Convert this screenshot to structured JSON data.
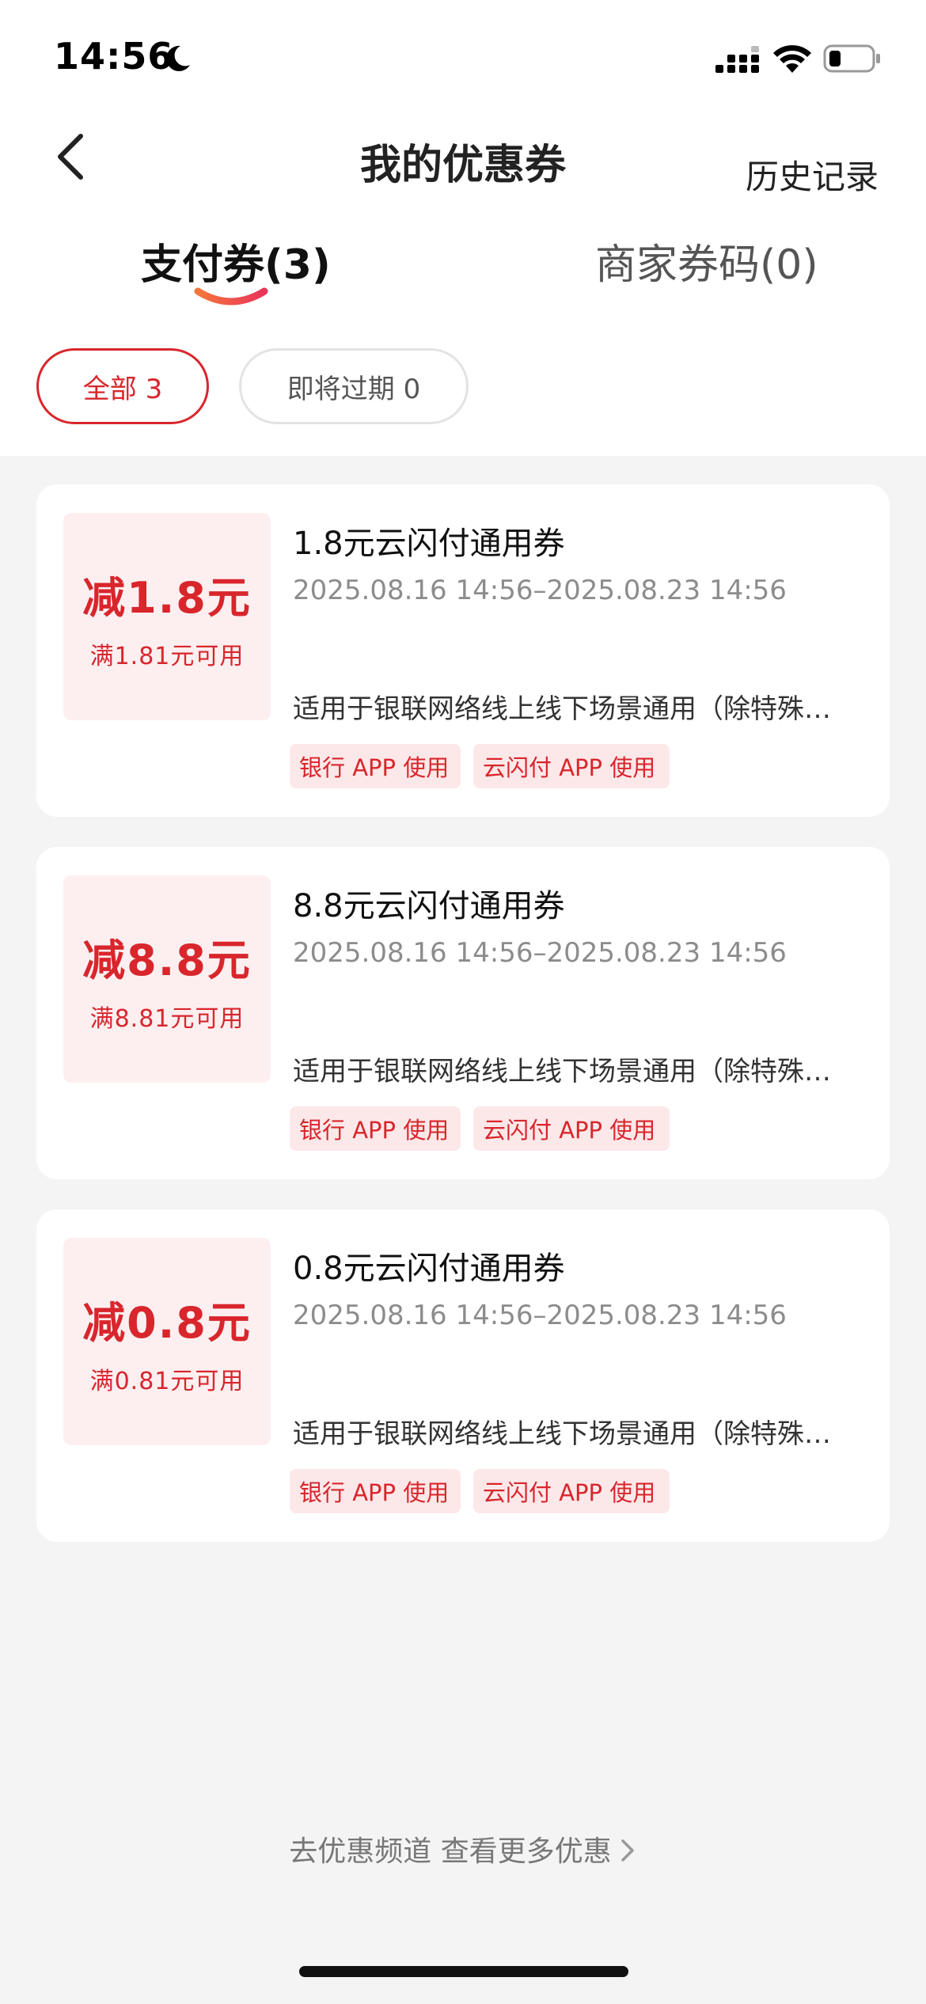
{
  "status_bar": {
    "time": "14:56"
  },
  "header": {
    "title": "我的优惠券",
    "history_label": "历史记录"
  },
  "tabs": [
    {
      "label": "支付券(3)",
      "active": true
    },
    {
      "label": "商家券码(0)",
      "active": false
    }
  ],
  "filters": [
    {
      "label": "全部 3",
      "selected": true
    },
    {
      "label": "即将过期 0",
      "selected": false
    }
  ],
  "coupons": [
    {
      "amount": "减1.8元",
      "condition": "满1.81元可用",
      "name": "1.8元云闪付通用券",
      "period": "2025.08.16 14:56–2025.08.23 14:56",
      "description": "适用于银联网络线上线下场景通用（除特殊…",
      "tags": [
        "银行 APP 使用",
        "云闪付 APP 使用"
      ]
    },
    {
      "amount": "减8.8元",
      "condition": "满8.81元可用",
      "name": "8.8元云闪付通用券",
      "period": "2025.08.16 14:56–2025.08.23 14:56",
      "description": "适用于银联网络线上线下场景通用（除特殊…",
      "tags": [
        "银行 APP 使用",
        "云闪付 APP 使用"
      ]
    },
    {
      "amount": "减0.8元",
      "condition": "满0.81元可用",
      "name": "0.8元云闪付通用券",
      "period": "2025.08.16 14:56–2025.08.23 14:56",
      "description": "适用于银联网络线上线下场景通用（除特殊…",
      "tags": [
        "银行 APP 使用",
        "云闪付 APP 使用"
      ]
    }
  ],
  "footer": {
    "more_link": "去优惠频道 查看更多优惠"
  },
  "colors": {
    "accent": "#d8262c",
    "coupon_bg": "#fdeff0",
    "tag_bg": "#fde8e9",
    "page_bg": "#f4f4f4",
    "tab_underline_start": "#f5763a",
    "tab_underline_end": "#e8345a"
  },
  "icons": {
    "status": [
      "moon-icon",
      "signal-icon",
      "wifi-icon",
      "battery-icon"
    ],
    "nav": [
      "back-arrow-icon",
      "chevron-right-icon"
    ]
  }
}
